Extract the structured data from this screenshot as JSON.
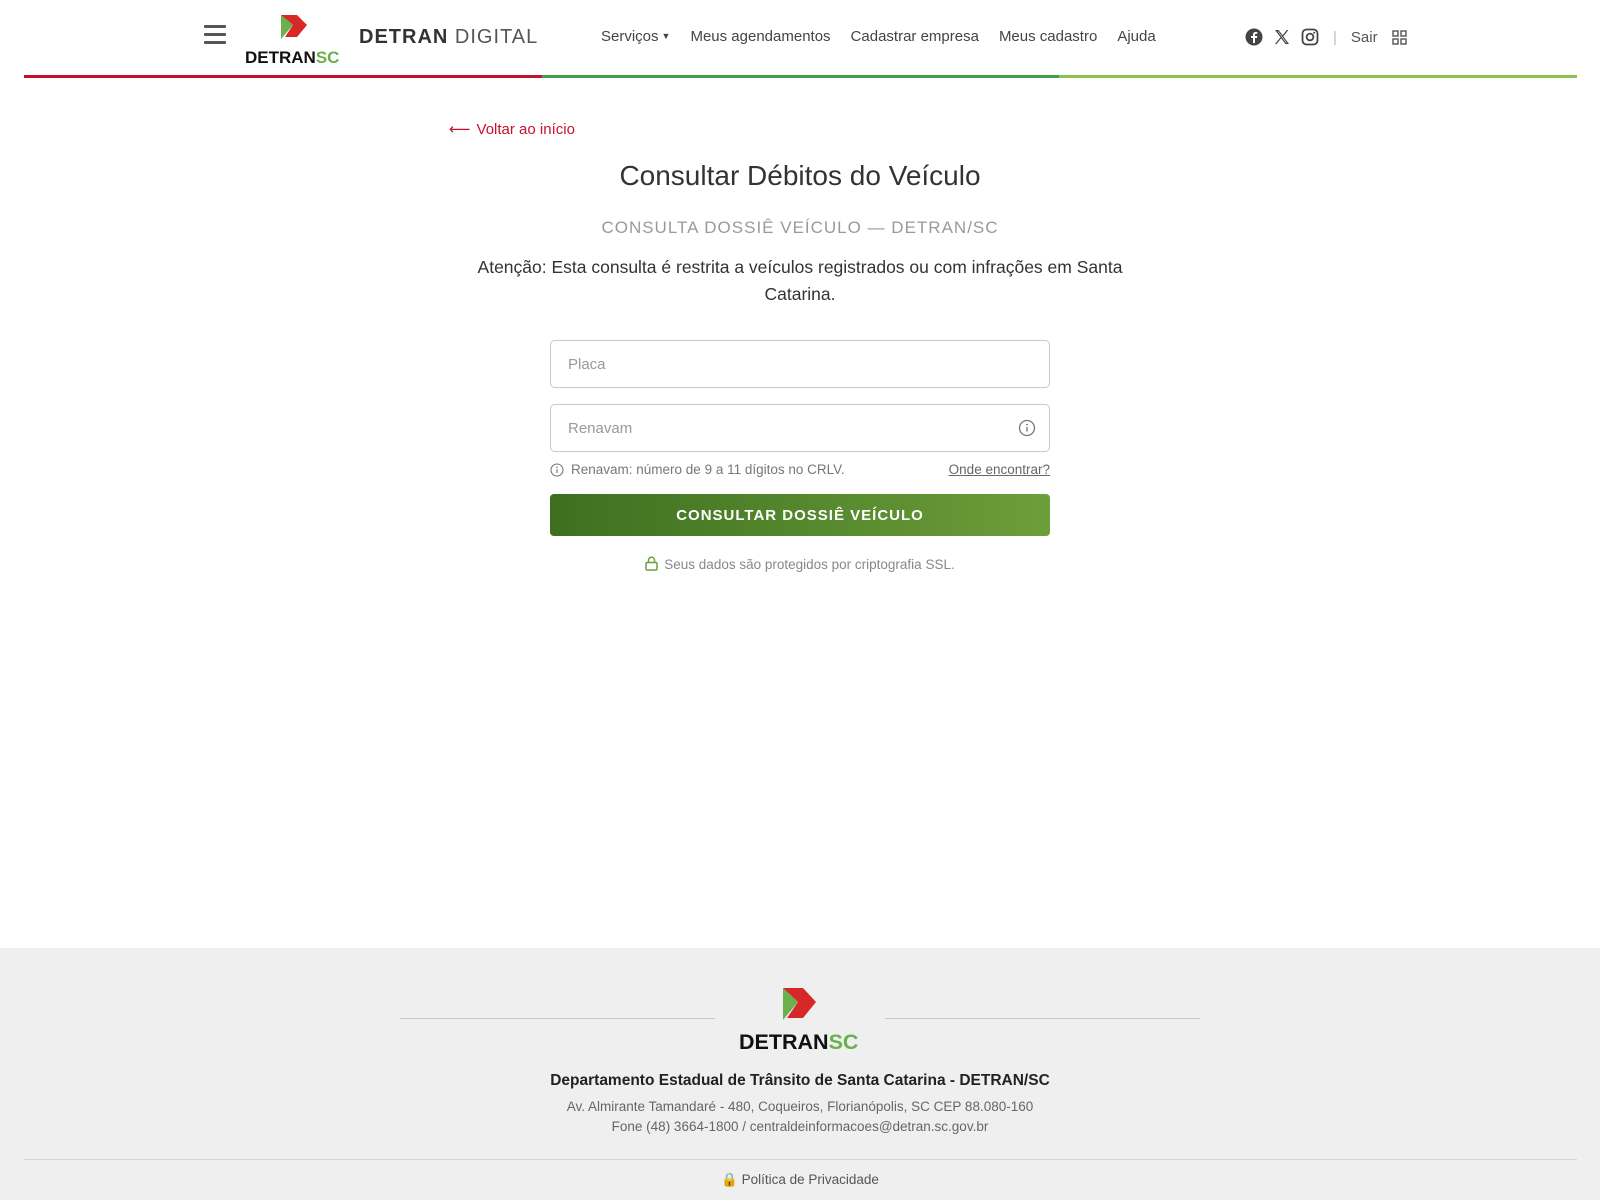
{
  "colors": {
    "brand_red": "#c8102e",
    "brand_green": "#3d6f1f",
    "brand_light_green": "#8bc34a",
    "stripe": [
      "#c8102e",
      "#43a047",
      "#8bc34a"
    ]
  },
  "header": {
    "brand_bold": "DETRAN",
    "brand_light": "DIGITAL",
    "logo_text_main": "DETRAN",
    "logo_text_accent": "SC",
    "nav": {
      "servicos": "Serviços",
      "agendamentos": "Meus agendamentos",
      "cadastrar": "Cadastrar empresa",
      "cadastro": "Meus cadastro",
      "ajuda": "Ajuda"
    },
    "social_icons": [
      "facebook-icon",
      "x-icon",
      "instagram-icon"
    ],
    "sair": "Sair"
  },
  "main": {
    "back_label": "Voltar ao início",
    "title": "Consultar Débitos do Veículo",
    "subtitle": "CONSULTA DOSSIÊ VEÍCULO — DETRAN/SC",
    "notice": "Atenção: Esta consulta é restrita a veículos registrados ou com infrações em Santa Catarina.",
    "placa_placeholder": "Placa",
    "placa_value": "",
    "renavam_placeholder": "Renavam",
    "renavam_value": "",
    "hint": "Renavam: número de 9 a 11 dígitos no CRLV.",
    "where_link": "Onde encontrar?",
    "button": "CONSULTAR DOSSIÊ VEÍCULO",
    "ssl_note": "Seus dados são protegidos por criptografia SSL."
  },
  "footer": {
    "org": "Departamento Estadual de Trânsito de Santa Catarina - DETRAN/SC",
    "address": "Av. Almirante Tamandaré - 480, Coqueiros, Florianópolis, SC CEP 88.080-160",
    "phone": "Fone (48) 3664-1800 / centraldeinformacoes@detran.sc.gov.br",
    "privacy": "🔒 Política de Privacidade"
  }
}
